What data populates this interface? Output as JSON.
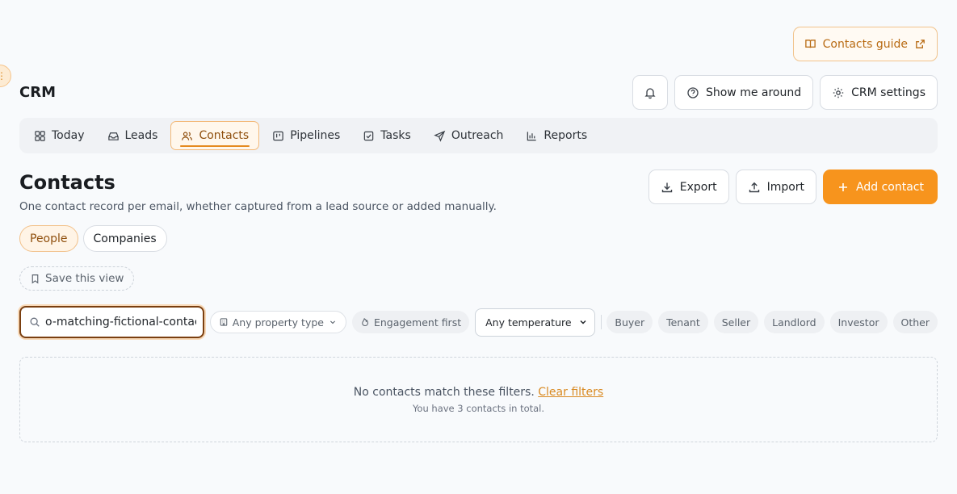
{
  "guide": {
    "label": "Contacts guide"
  },
  "app": {
    "title": "CRM"
  },
  "top_actions": {
    "tour_label": "Show me around",
    "settings_label": "CRM settings"
  },
  "nav": {
    "items": [
      {
        "label": "Today",
        "icon": "grid-icon"
      },
      {
        "label": "Leads",
        "icon": "inbox-icon"
      },
      {
        "label": "Contacts",
        "icon": "users-icon",
        "active": true
      },
      {
        "label": "Pipelines",
        "icon": "kanban-icon"
      },
      {
        "label": "Tasks",
        "icon": "checkbox-icon"
      },
      {
        "label": "Outreach",
        "icon": "send-icon"
      },
      {
        "label": "Reports",
        "icon": "bar-chart-icon"
      }
    ]
  },
  "page": {
    "title": "Contacts",
    "subtitle": "One contact record per email, whether captured from a lead source or added manually.",
    "export_label": "Export",
    "import_label": "Import",
    "add_label": "Add contact"
  },
  "segments": {
    "people": "People",
    "companies": "Companies",
    "active": "People"
  },
  "save_view": {
    "label": "Save this view"
  },
  "filters": {
    "search_value": "o-matching-fictional-contact-qa",
    "property_type": "Any property type",
    "engagement": "Engagement first",
    "temperature": "Any temperature",
    "roles": [
      "Buyer",
      "Tenant",
      "Seller",
      "Landlord",
      "Investor",
      "Other"
    ]
  },
  "empty_state": {
    "message": "No contacts match these filters.",
    "clear_label": "Clear filters",
    "total": "You have 3 contacts in total."
  },
  "colors": {
    "accent": "#f7941d",
    "accent_dark": "#8f4f0d",
    "focus_border": "#7a3f10"
  }
}
